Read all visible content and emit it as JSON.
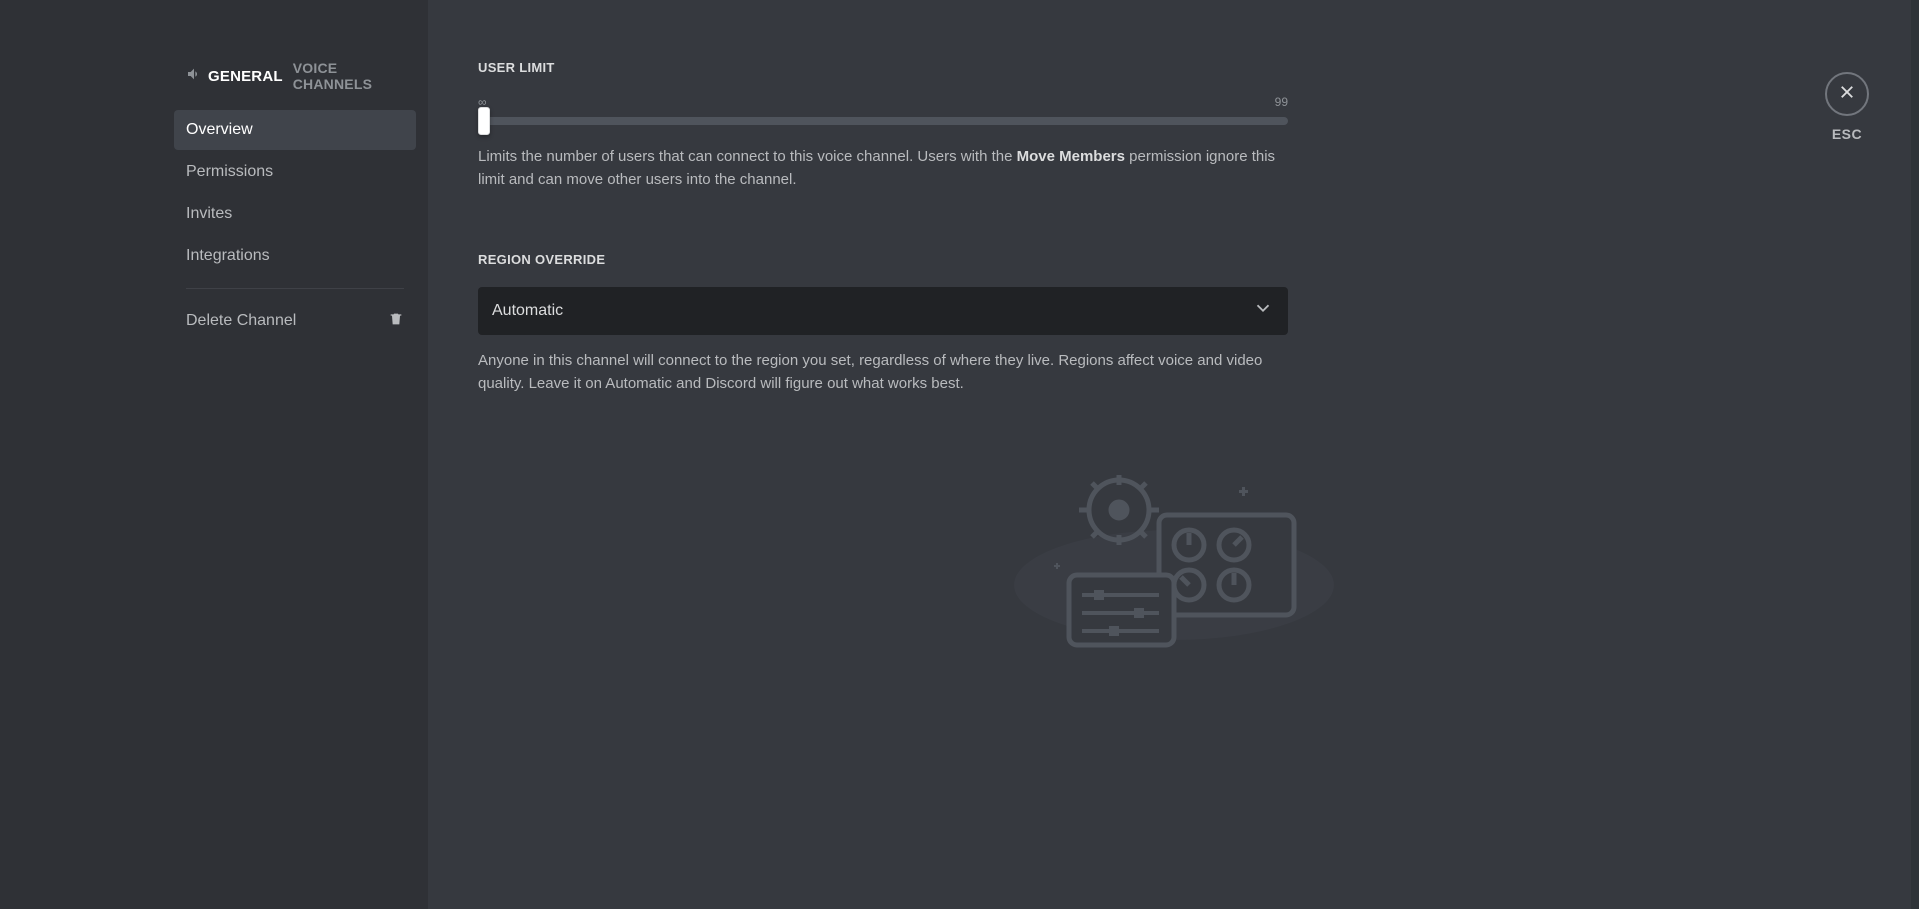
{
  "sidebar": {
    "channel_name": "GENERAL",
    "channel_sub": "VOICE CHANNELS",
    "items": [
      {
        "label": "Overview"
      },
      {
        "label": "Permissions"
      },
      {
        "label": "Invites"
      },
      {
        "label": "Integrations"
      }
    ],
    "delete_label": "Delete Channel"
  },
  "user_limit": {
    "label": "USER LIMIT",
    "min_label": "∞",
    "max_label": "99",
    "help_pre": "Limits the number of users that can connect to this voice channel. Users with the ",
    "help_strong": "Move Members",
    "help_post": " permission ignore this limit and can move other users into the channel."
  },
  "region": {
    "label": "REGION OVERRIDE",
    "selected": "Automatic",
    "help": "Anyone in this channel will connect to the region you set, regardless of where they live. Regions affect voice and video quality. Leave it on Automatic and Discord will figure out what works best."
  },
  "close": {
    "label": "ESC"
  }
}
